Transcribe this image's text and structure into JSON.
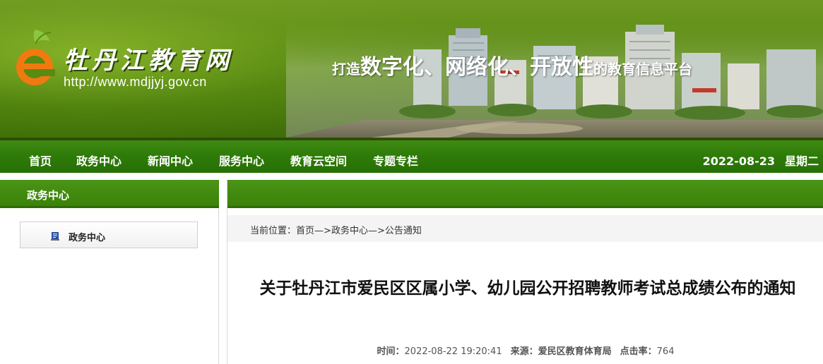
{
  "site": {
    "title": "牡丹江教育网",
    "url": "http://www.mdjjyj.gov.cn",
    "slogan": {
      "prefix": "打造",
      "word1": "数字化",
      "sep1": "、",
      "word2": "网络化",
      "sep2": "、",
      "word3": "开放性",
      "suffix": "的教育信息平台"
    },
    "colors": {
      "brand_green": "#3b8209",
      "banner_green": "#5a8a12",
      "logo_orange": "#f07a10"
    }
  },
  "nav": {
    "items": [
      "首页",
      "政务中心",
      "新闻中心",
      "服务中心",
      "教育云空间",
      "专题专栏"
    ],
    "date": "2022-08-23",
    "weekday": "星期二"
  },
  "sidebar": {
    "heading": "政务中心",
    "items": [
      {
        "label": "政务中心",
        "icon": "document-icon"
      }
    ]
  },
  "breadcrumb": {
    "prefix": "当前位置：",
    "home": "首页",
    "sep1": "—>",
    "section": "政务中心",
    "sep2": "—>",
    "current": "公告通知"
  },
  "article": {
    "title": "关于牡丹江市爱民区区属小学、幼儿园公开招聘教师考试总成绩公布的通知",
    "time_label": "时间：",
    "time": "2022-08-22 19:20:41",
    "source_label": "来源：",
    "source": "爱民区教育体育局",
    "clicks_label": "点击率：",
    "clicks": "764"
  }
}
